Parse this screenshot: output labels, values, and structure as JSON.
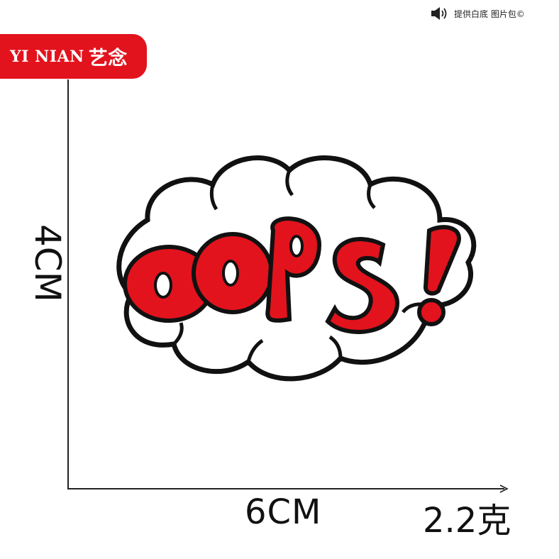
{
  "brand": {
    "latin": "YI NIAN",
    "chinese": "艺念"
  },
  "top_note": {
    "icon": "speaker-icon",
    "text": "提供白底 图片包©"
  },
  "dimensions": {
    "height": "4CM",
    "width": "6CM",
    "weight": "2.2克"
  },
  "patch": {
    "word": "OOPS!",
    "colors": {
      "fill": "#e2131d",
      "outline": "#111111",
      "base": "#ffffff"
    }
  }
}
